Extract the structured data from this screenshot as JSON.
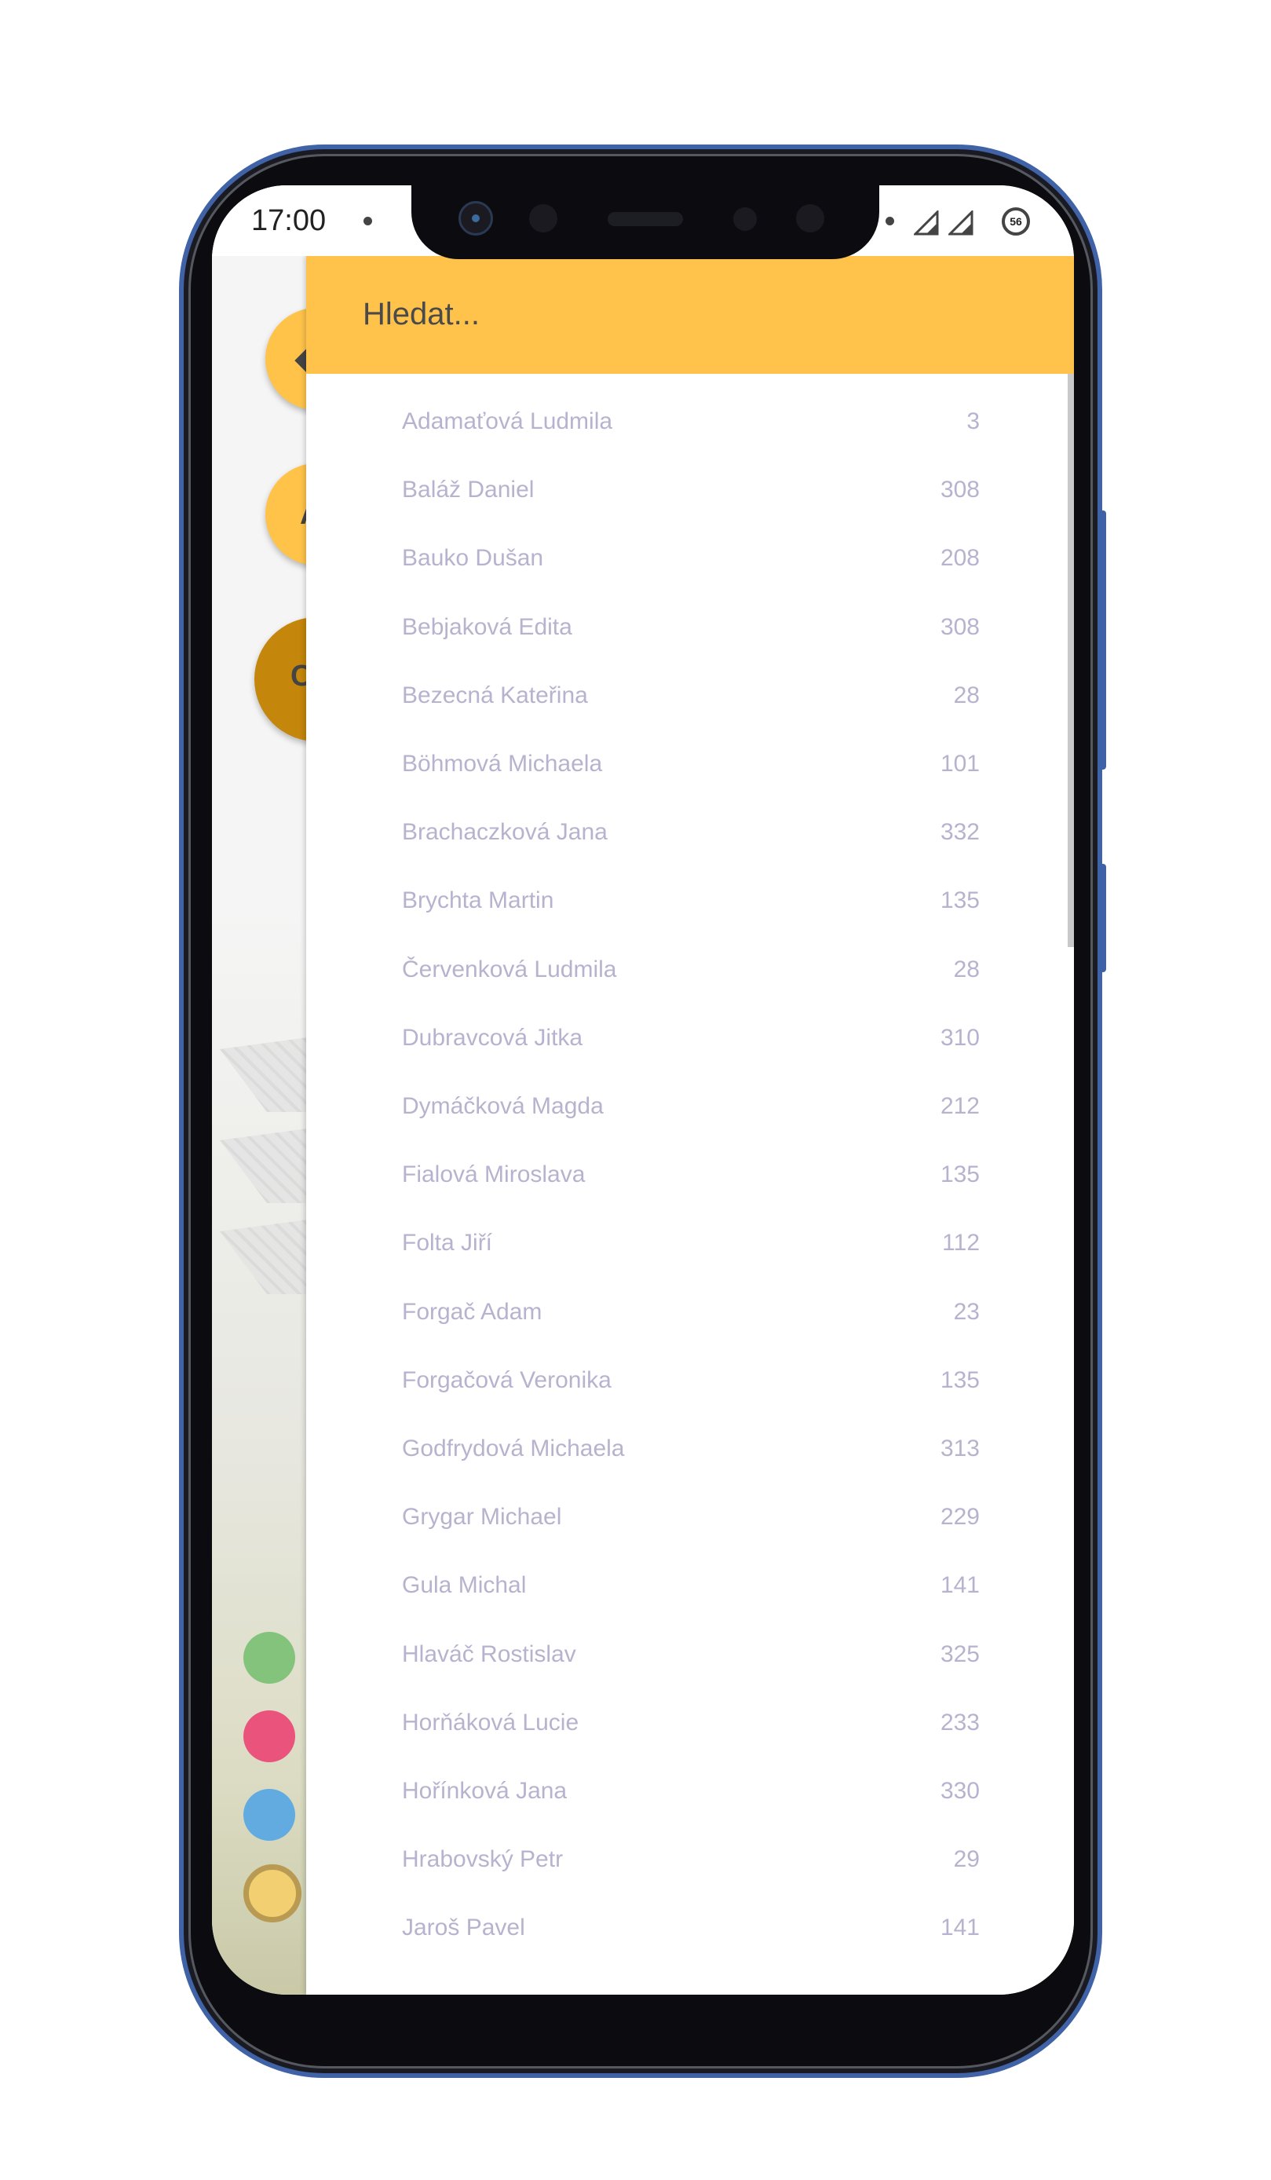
{
  "status_bar": {
    "time": "17:00",
    "battery": "56"
  },
  "search": {
    "placeholder": "Hledat..."
  },
  "results": [
    {
      "name": "Adamaťová Ludmila",
      "number": "3"
    },
    {
      "name": "Baláž Daniel",
      "number": "308"
    },
    {
      "name": "Bauko Dušan",
      "number": "208"
    },
    {
      "name": "Bebjaková Edita",
      "number": "308"
    },
    {
      "name": "Bezecná Kateřina",
      "number": "28"
    },
    {
      "name": "Böhmová Michaela",
      "number": "101"
    },
    {
      "name": "Brachaczková Jana",
      "number": "332"
    },
    {
      "name": "Brychta Martin",
      "number": "135"
    },
    {
      "name": "Červenková Ludmila",
      "number": "28"
    },
    {
      "name": "Dubravcová Jitka",
      "number": "310"
    },
    {
      "name": "Dymáčková Magda",
      "number": "212"
    },
    {
      "name": "Fialová Miroslava",
      "number": "135"
    },
    {
      "name": "Folta Jiří",
      "number": "112"
    },
    {
      "name": "Forgač Adam",
      "number": "23"
    },
    {
      "name": "Forgačová Veronika",
      "number": "135"
    },
    {
      "name": "Godfrydová Michaela",
      "number": "313"
    },
    {
      "name": "Grygar Michael",
      "number": "229"
    },
    {
      "name": "Gula Michal",
      "number": "141"
    },
    {
      "name": "Hlaváč Rostislav",
      "number": "325"
    },
    {
      "name": "Horňáková Lucie",
      "number": "233"
    },
    {
      "name": "Hořínková Jana",
      "number": "330"
    },
    {
      "name": "Hrabovský Petr",
      "number": "29"
    },
    {
      "name": "Jaroš Pavel",
      "number": "141"
    }
  ],
  "background_app": {
    "legend_dots": [
      "#83c37c",
      "#e9537c",
      "#61abe1",
      "#f2cf70"
    ]
  }
}
